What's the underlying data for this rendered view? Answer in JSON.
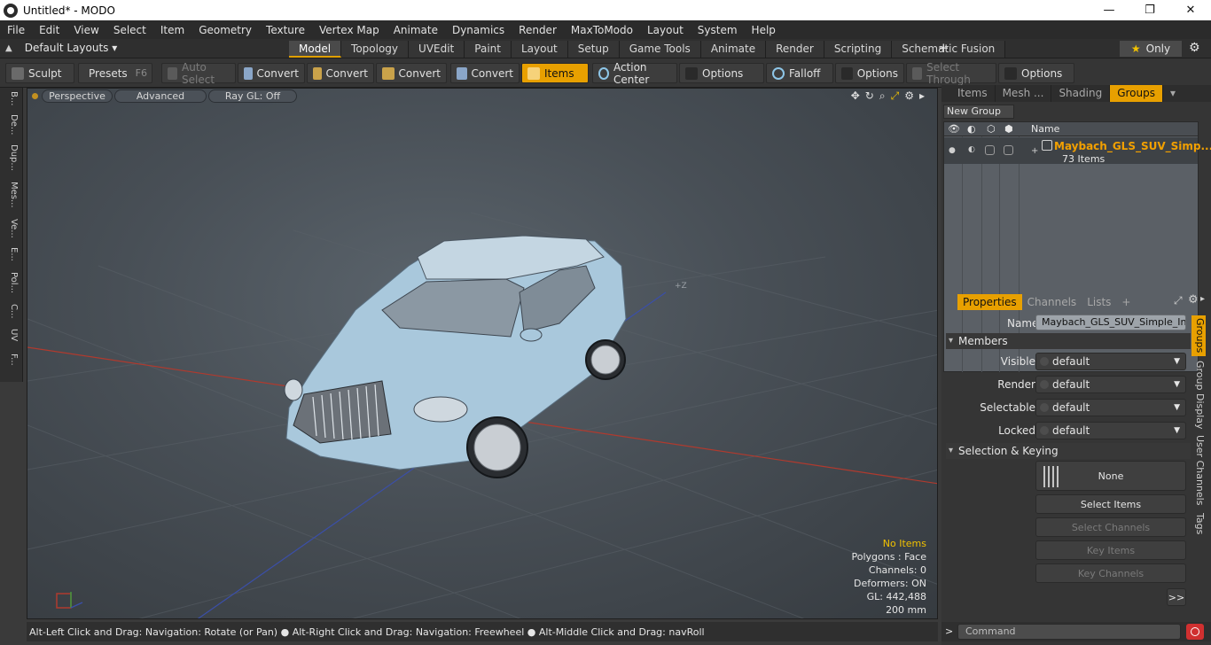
{
  "window": {
    "title": "Untitled* - MODO",
    "minimize": "—",
    "maximize": "❐",
    "close": "✕"
  },
  "menu": [
    "File",
    "Edit",
    "View",
    "Select",
    "Item",
    "Geometry",
    "Texture",
    "Vertex Map",
    "Animate",
    "Dynamics",
    "Render",
    "MaxToModo",
    "Layout",
    "System",
    "Help"
  ],
  "layout_bar": {
    "layouts_dropdown": "Default Layouts ▾",
    "tabs": [
      "Model",
      "Topology",
      "UVEdit",
      "Paint",
      "Layout",
      "Setup",
      "Game Tools",
      "Animate",
      "Render",
      "Scripting",
      "Schematic Fusion"
    ],
    "active_tab": "Model",
    "only_label": "Only"
  },
  "toolbar": {
    "sculpt": "Sculpt",
    "presets": "Presets",
    "presets_key": "F6",
    "auto_select": "Auto Select",
    "convert1": "Convert",
    "convert2": "Convert",
    "convert3": "Convert",
    "convert4": "Convert",
    "items": "Items",
    "action_center": "Action Center",
    "options1": "Options",
    "falloff": "Falloff",
    "options2": "Options",
    "select_through": "Select Through",
    "options3": "Options"
  },
  "left_strip": [
    "B...",
    "De...",
    "Dup...",
    "Mes...",
    "Ve...",
    "E...",
    "Pol...",
    "C...",
    "UV",
    "F..."
  ],
  "viewport": {
    "perspective": "Perspective",
    "advanced": "Advanced",
    "raygl": "Ray GL: Off",
    "axis_z": "+Z",
    "stats": {
      "selection": "No Items",
      "polygons": "Polygons : Face",
      "channels": "Channels: 0",
      "deformers": "Deformers: ON",
      "gl": "GL: 442,488",
      "scale": "200 mm"
    }
  },
  "status": "Alt-Left Click and Drag: Navigation: Rotate (or Pan) ● Alt-Right Click and Drag: Navigation: Freewheel ● Alt-Middle Click and Drag: navRoll",
  "right_panel": {
    "tabs": [
      "Items",
      "Mesh ...",
      "Shading",
      "Groups"
    ],
    "active_tab": "Groups",
    "new_group": "New Group",
    "col_name": "Name",
    "group_name": "Maybach_GLS_SUV_Simp...",
    "group_count": "73 Items",
    "props_tabs": [
      "Properties",
      "Channels",
      "Lists"
    ],
    "name_label": "Name",
    "name_value": "Maybach_GLS_SUV_Simple_Inter",
    "members_label": "Members",
    "visible_label": "Visible",
    "visible_value": "default",
    "render_label": "Render",
    "render_value": "default",
    "selectable_label": "Selectable",
    "selectable_value": "default",
    "locked_label": "Locked",
    "locked_value": "default",
    "selection_keying_label": "Selection & Keying",
    "none_btn": "None",
    "select_items": "Select Items",
    "select_channels": "Select Channels",
    "key_items": "Key Items",
    "key_channels": "Key Channels",
    "more": ">>",
    "vertical_tabs": [
      "Groups",
      "Group Display",
      "User Channels",
      "Tags"
    ]
  },
  "command": {
    "prompt": ">",
    "placeholder": "Command"
  },
  "colors": {
    "accent": "#e8a000",
    "group_name": "#f2a000",
    "car_body": "#a9c8dc"
  }
}
